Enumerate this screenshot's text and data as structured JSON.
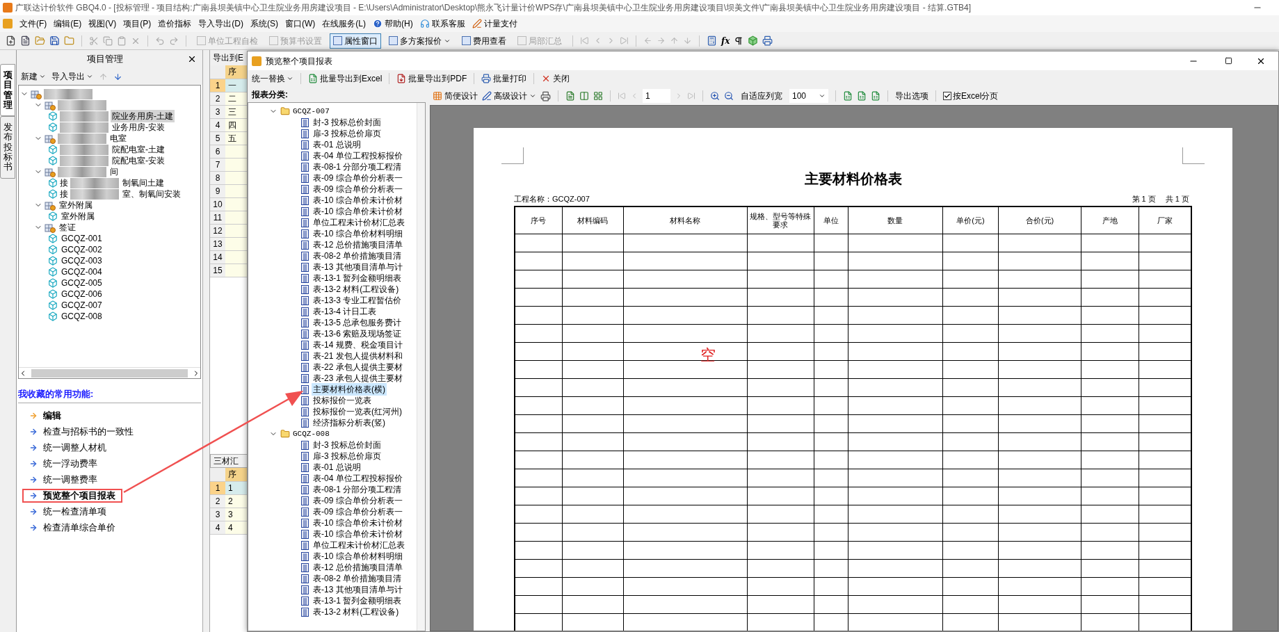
{
  "main_window": {
    "title": "广联达计价软件 GBQ4.0 - [投标管理 - 项目结构:广南县坝美镇中心卫生院业务用房建设项目 - E:\\Users\\Administrator\\Desktop\\熊永飞计量计价WPS存\\广南县坝美镇中心卫生院业务用房建设项目\\坝美文件\\广南县坝美镇中心卫生院业务用房建设项目 - 结算.GTB4]",
    "menu": [
      {
        "label": "文件(F)",
        "kind": "plain"
      },
      {
        "label": "编辑(E)",
        "kind": "plain"
      },
      {
        "label": "视图(V)",
        "kind": "plain"
      },
      {
        "label": "项目(P)",
        "kind": "plain"
      },
      {
        "label": "造价指标",
        "kind": "plain"
      },
      {
        "label": "导入导出(D)",
        "kind": "plain"
      },
      {
        "label": "系统(S)",
        "kind": "plain"
      },
      {
        "label": "窗口(W)",
        "kind": "plain"
      },
      {
        "label": "在线服务(L)",
        "kind": "plain"
      },
      {
        "label": "帮助(H)",
        "kind": "help"
      },
      {
        "label": "联系客服",
        "kind": "support"
      },
      {
        "label": "计量支付",
        "kind": "pay"
      }
    ],
    "toolbar": [
      {
        "label": "单位工程自检",
        "disabled": true,
        "pressed": false,
        "dropdown": false
      },
      {
        "label": "预算书设置",
        "disabled": true,
        "pressed": false,
        "dropdown": false
      },
      {
        "label": "属性窗口",
        "disabled": false,
        "pressed": true,
        "dropdown": false
      },
      {
        "label": "多方案报价",
        "disabled": false,
        "pressed": false,
        "dropdown": true
      },
      {
        "label": "费用查看",
        "disabled": false,
        "pressed": false,
        "dropdown": false
      },
      {
        "label": "局部汇总",
        "disabled": true,
        "pressed": false,
        "dropdown": false
      }
    ],
    "formula_tool": "fx"
  },
  "side_tabs": [
    {
      "label": "项目管理",
      "selected": true
    },
    {
      "label": "发布投标书",
      "selected": false
    }
  ],
  "project_panel": {
    "title": "项目管理",
    "new_button": "新建",
    "import_export_button": "导入导出",
    "tree": {
      "blurred": true,
      "expanded": true,
      "children": [
        {
          "blurred": true,
          "expanded": true,
          "children": [
            {
              "label": "院业务用房-土建",
              "blurred": true,
              "selected": true
            },
            {
              "label": "业务用房-安装",
              "blurred": true,
              "selected": false
            }
          ]
        },
        {
          "label": "电室",
          "blurred": true,
          "expanded": true,
          "children": [
            {
              "label": "院配电室-土建",
              "blurred": true,
              "selected": false
            },
            {
              "label": "院配电室-安装",
              "blurred": true,
              "selected": false
            }
          ]
        },
        {
          "label": "间",
          "blurred": true,
          "expanded": true,
          "children": [
            {
              "prefix": "接",
              "label": "制氧间土建",
              "blurred": true,
              "selected": false
            },
            {
              "prefix": "接",
              "label": "室、制氧间安装",
              "blurred": true,
              "selected": false
            }
          ]
        },
        {
          "label": "室外附属",
          "blurred": false,
          "expanded": true,
          "children": [
            {
              "label": "室外附属",
              "blurred": false,
              "selected": false
            }
          ]
        },
        {
          "label": "签证",
          "blurred": false,
          "expanded": true,
          "children": [
            {
              "label": "GCQZ-001",
              "blurred": false,
              "selected": false
            },
            {
              "label": "GCQZ-002",
              "blurred": false,
              "selected": false
            },
            {
              "label": "GCQZ-003",
              "blurred": false,
              "selected": false
            },
            {
              "label": "GCQZ-004",
              "blurred": false,
              "selected": false
            },
            {
              "label": "GCQZ-005",
              "blurred": false,
              "selected": false
            },
            {
              "label": "GCQZ-006",
              "blurred": false,
              "selected": false
            },
            {
              "label": "GCQZ-007",
              "blurred": false,
              "selected": false
            },
            {
              "label": "GCQZ-008",
              "blurred": false,
              "selected": false
            }
          ]
        }
      ]
    },
    "favorites_title": "我收藏的常用功能:",
    "favorites": [
      {
        "label": "编辑",
        "bold": true,
        "active": true,
        "boxed": false
      },
      {
        "label": "检查与招标书的一致性",
        "bold": false,
        "active": false,
        "boxed": false
      },
      {
        "label": "统一调整人材机",
        "bold": false,
        "active": false,
        "boxed": false
      },
      {
        "label": "统一浮动费率",
        "bold": false,
        "active": false,
        "boxed": false
      },
      {
        "label": "统一调整费率",
        "bold": false,
        "active": false,
        "boxed": false
      },
      {
        "label": "预览整个项目报表",
        "bold": true,
        "active": false,
        "boxed": true
      },
      {
        "label": "统一检查清单项",
        "bold": false,
        "active": false,
        "boxed": false
      },
      {
        "label": "检查清单综合单价",
        "bold": false,
        "active": false,
        "boxed": false
      }
    ]
  },
  "middle_grid": {
    "tab": "导出到E",
    "header": "序",
    "rows": [
      {
        "number": "1",
        "cell": "一",
        "selected": true
      },
      {
        "number": "2",
        "cell": "二",
        "selected": false
      },
      {
        "number": "3",
        "cell": "三",
        "selected": false
      },
      {
        "number": "4",
        "cell": "四",
        "selected": false
      },
      {
        "number": "5",
        "cell": "五",
        "selected": false
      },
      {
        "number": "6",
        "selected": false
      },
      {
        "number": "7",
        "selected": false
      },
      {
        "number": "8",
        "selected": false
      },
      {
        "number": "9",
        "selected": false
      },
      {
        "number": "10",
        "selected": false
      },
      {
        "number": "11",
        "selected": false
      },
      {
        "number": "12",
        "selected": false
      },
      {
        "number": "13",
        "selected": false
      },
      {
        "number": "14",
        "selected": false
      },
      {
        "number": "15",
        "selected": false
      }
    ],
    "bottom_tab": "三材汇",
    "bottom_header": "序",
    "bottom_rows": [
      {
        "number": "1",
        "cell": "1",
        "selected": true
      },
      {
        "number": "2",
        "cell": "2",
        "selected": false
      },
      {
        "number": "3",
        "cell": "3",
        "selected": false
      },
      {
        "number": "4",
        "cell": "4",
        "selected": false
      }
    ]
  },
  "dialog": {
    "title": "预览整个项目报表",
    "replace_button": "统一替换",
    "export_excel": "批量导出到Excel",
    "export_pdf": "批量导出到PDF",
    "print": "批量打印",
    "close": "关闭",
    "category_label": "报表分类:",
    "report_tree": [
      {
        "label": "GCQZ-007",
        "expanded": true,
        "children": [
          {
            "label": "封-3 投标总价封面",
            "selected": false
          },
          {
            "label": "扉-3 投标总价扉页",
            "selected": false
          },
          {
            "label": "表-01 总说明",
            "selected": false
          },
          {
            "label": "表-04 单位工程投标报价",
            "selected": false
          },
          {
            "label": "表-08-1 分部分项工程清",
            "selected": false
          },
          {
            "label": "表-09 综合单价分析表一",
            "selected": false
          },
          {
            "label": "表-09 综合单价分析表一",
            "selected": false
          },
          {
            "label": "表-10 综合单价未计价材",
            "selected": false
          },
          {
            "label": "表-10 综合单价未计价材",
            "selected": false
          },
          {
            "label": "单位工程未计价材汇总表",
            "selected": false
          },
          {
            "label": "表-10 综合单价材料明细",
            "selected": false
          },
          {
            "label": "表-12 总价措施项目清单",
            "selected": false
          },
          {
            "label": "表-08-2 单价措施项目清",
            "selected": false
          },
          {
            "label": "表-13 其他项目清单与计",
            "selected": false
          },
          {
            "label": "表-13-1 暂列金额明细表",
            "selected": false
          },
          {
            "label": "表-13-2 材料(工程设备)",
            "selected": false
          },
          {
            "label": "表-13-3 专业工程暂估价",
            "selected": false
          },
          {
            "label": "表-13-4 计日工表",
            "selected": false
          },
          {
            "label": "表-13-5 总承包服务费计",
            "selected": false
          },
          {
            "label": "表-13-6 索赔及现场签证",
            "selected": false
          },
          {
            "label": "表-14 规费、税金项目计",
            "selected": false
          },
          {
            "label": "表-21 发包人提供材料和",
            "selected": false
          },
          {
            "label": "表-22 承包人提供主要材",
            "selected": false
          },
          {
            "label": "表-23 承包人提供主要材",
            "selected": false
          },
          {
            "label": "主要材料价格表(横)",
            "selected": true
          },
          {
            "label": "投标报价一览表",
            "selected": false
          },
          {
            "label": "投标报价一览表(红河州)",
            "selected": false
          },
          {
            "label": "经济指标分析表(竖)",
            "selected": false
          }
        ]
      },
      {
        "label": "GCQZ-008",
        "expanded": true,
        "children": [
          {
            "label": "封-3 投标总价封面",
            "selected": false
          },
          {
            "label": "扉-3 投标总价扉页",
            "selected": false
          },
          {
            "label": "表-01 总说明",
            "selected": false
          },
          {
            "label": "表-04 单位工程投标报价",
            "selected": false
          },
          {
            "label": "表-08-1 分部分项工程清",
            "selected": false
          },
          {
            "label": "表-09 综合单价分析表一",
            "selected": false
          },
          {
            "label": "表-09 综合单价分析表一",
            "selected": false
          },
          {
            "label": "表-10 综合单价未计价材",
            "selected": false
          },
          {
            "label": "表-10 综合单价未计价材",
            "selected": false
          },
          {
            "label": "单位工程未计价材汇总表",
            "selected": false
          },
          {
            "label": "表-10 综合单价材料明细",
            "selected": false
          },
          {
            "label": "表-12 总价措施项目清单",
            "selected": false
          },
          {
            "label": "表-08-2 单价措施项目清",
            "selected": false
          },
          {
            "label": "表-13 其他项目清单与计",
            "selected": false
          },
          {
            "label": "表-13-1 暂列金额明细表",
            "selected": false
          },
          {
            "label": "表-13-2 材料(工程设备)",
            "selected": false
          }
        ]
      }
    ],
    "preview_toolbar": {
      "simple_design": "简便设计",
      "advanced_design": "高级设计",
      "page_number": "1",
      "fit_width": "自适应列宽",
      "zoom": "100",
      "export_options": "导出选项",
      "excel_paging": {
        "label": "按Excel分页",
        "checked": true
      }
    },
    "page": {
      "title": "主要材料价格表",
      "project_label": "工程名称：GCQZ-007",
      "page_current": "第 1 页",
      "page_total": "共 1 页",
      "columns": [
        "序号",
        "材料编码",
        "材料名称",
        "规格、型号等特殊要求",
        "单位",
        "数量",
        "单价(元)",
        "合价(元)",
        "产地",
        "厂家"
      ],
      "empty_note": "空"
    }
  }
}
